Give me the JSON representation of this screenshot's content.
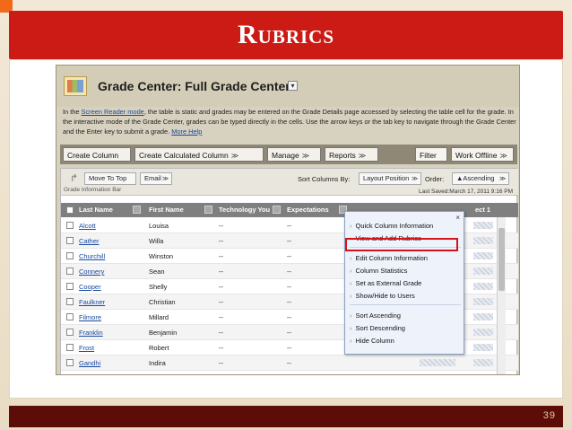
{
  "slide": {
    "title": "Rubrics",
    "page_number": "39"
  },
  "grade_center": {
    "title": "Grade Center: Full Grade Center",
    "description_pre": "In the ",
    "screen_reader_link": "Screen Reader mode",
    "description_post": ", the table is static and grades may be entered on the Grade Details page accessed by selecting the table cell for the grade. In the interactive mode of the Grade Center, grades can be typed directly in the cells. Use the arrow keys or the tab key to navigate through the Grade Center and the Enter key to submit a grade.",
    "more_help": "More Help"
  },
  "action_bar": {
    "create_column": "Create Column",
    "create_calculated_column": "Create Calculated Column",
    "manage": "Manage",
    "reports": "Reports",
    "filter": "Filter",
    "work_offline": "Work Offline"
  },
  "toolbar": {
    "move_to_top": "Move To Top",
    "email": "Email",
    "sort_columns_by": "Sort Columns By:",
    "sort_value": "Layout Position",
    "order_label": "Order:",
    "order_value": "▲Ascending",
    "grade_information_bar": "Grade Information Bar",
    "last_saved": "Last Saved:March 17, 2011 9:16 PM"
  },
  "columns": [
    "Last Name",
    "First Name",
    "Technology You",
    "Expectations",
    "ect 1"
  ],
  "rows": [
    {
      "last": "Alcott",
      "first": "Louisa",
      "c3": "--",
      "c4": "--"
    },
    {
      "last": "Cather",
      "first": "Willa",
      "c3": "--",
      "c4": "--"
    },
    {
      "last": "Churchill",
      "first": "Winston",
      "c3": "--",
      "c4": "--"
    },
    {
      "last": "Connery",
      "first": "Sean",
      "c3": "--",
      "c4": "--"
    },
    {
      "last": "Cooper",
      "first": "Shelly",
      "c3": "--",
      "c4": "--"
    },
    {
      "last": "Faulkner",
      "first": "Christian",
      "c3": "--",
      "c4": "--"
    },
    {
      "last": "Filmore",
      "first": "Millard",
      "c3": "--",
      "c4": "--"
    },
    {
      "last": "Franklin",
      "first": "Benjamin",
      "c3": "--",
      "c4": "--"
    },
    {
      "last": "Frost",
      "first": "Robert",
      "c3": "--",
      "c4": "--"
    },
    {
      "last": "Gandhi",
      "first": "Indira",
      "c3": "--",
      "c4": "--"
    }
  ],
  "context_menu": {
    "close": "×",
    "items": [
      "Quick Column Information",
      "View and Add Rubrics",
      "Edit Column Information",
      "Column Statistics",
      "Set as External Grade",
      "Show/Hide to Users",
      "Sort Ascending",
      "Sort Descending",
      "Hide Column"
    ]
  },
  "colors": {
    "title_bar": "#cc1a14",
    "footer": "#5c0d08",
    "highlight": "#d4141c"
  }
}
